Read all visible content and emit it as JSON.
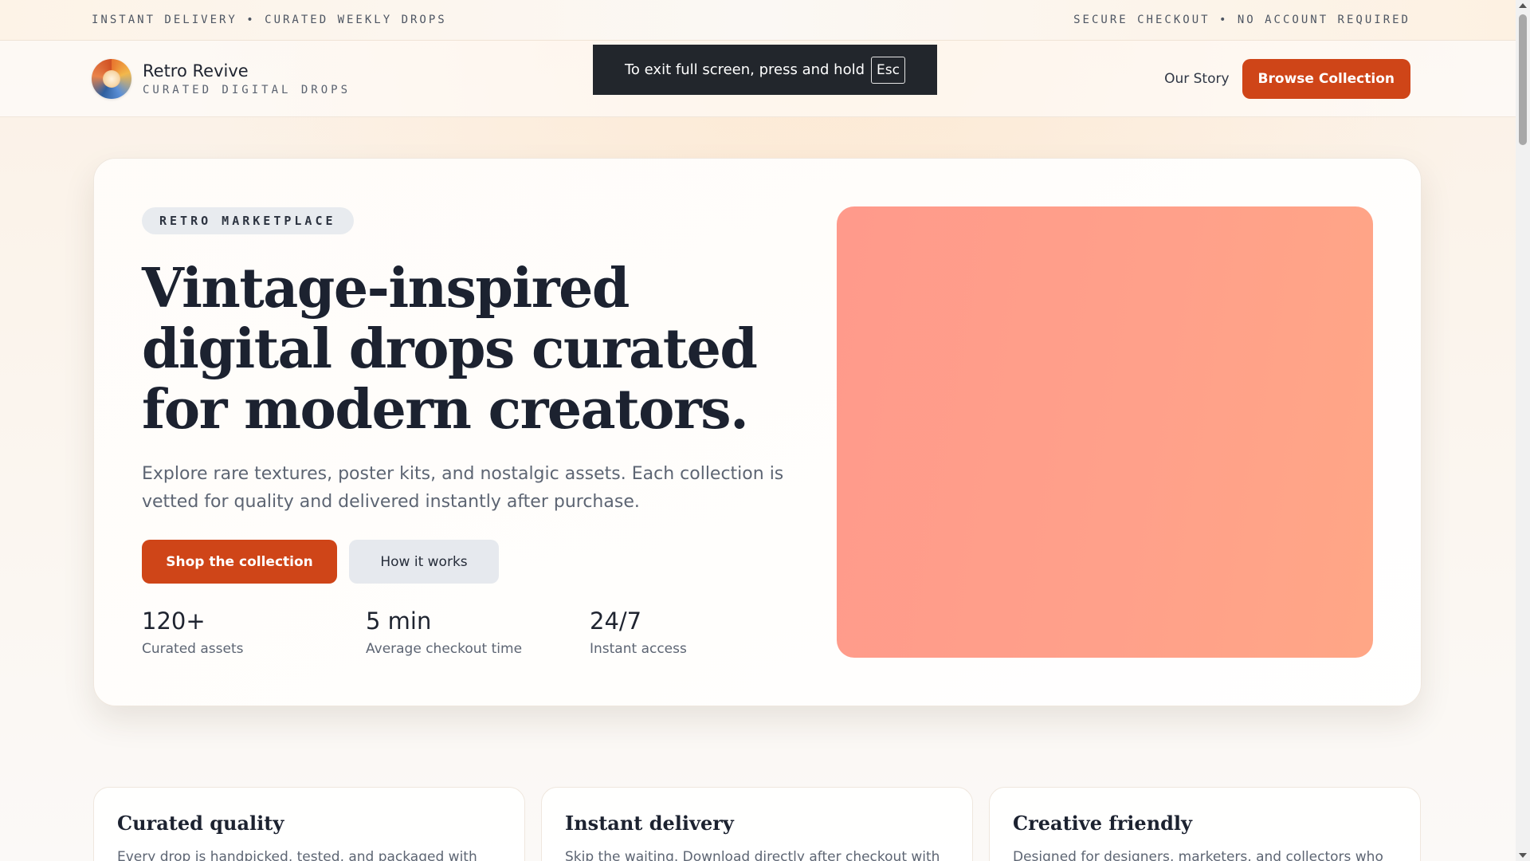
{
  "announce": {
    "left": "INSTANT DELIVERY • CURATED WEEKLY DROPS",
    "right": "SECURE CHECKOUT • NO ACCOUNT REQUIRED"
  },
  "header": {
    "brand_name": "Retro Revive",
    "brand_sub": "CURATED DIGITAL DROPS",
    "nav_link": "Our Story",
    "cta": "Browse Collection"
  },
  "toast": {
    "text": "To exit full screen, press and hold",
    "key": "Esc"
  },
  "hero": {
    "tag": "RETRO MARKETPLACE",
    "title": "Vintage-inspired digital drops curated for modern creators.",
    "description": "Explore rare textures, poster kits, and nostalgic assets. Each collection is vetted for quality and delivered instantly after purchase.",
    "primary_button": "Shop the collection",
    "secondary_button": "How it works",
    "stats": [
      {
        "value": "120+",
        "label": "Curated assets"
      },
      {
        "value": "5 min",
        "label": "Average checkout time"
      },
      {
        "value": "24/7",
        "label": "Instant access"
      }
    ]
  },
  "features": [
    {
      "title": "Curated quality",
      "text": "Every drop is handpicked, tested, and packaged with"
    },
    {
      "title": "Instant delivery",
      "text": "Skip the waiting. Download directly after checkout with"
    },
    {
      "title": "Creative friendly",
      "text": "Designed for designers, marketers, and collectors who"
    }
  ],
  "colors": {
    "accent": "#cf4518",
    "hero_art_start": "#ff9a8b",
    "hero_art_end": "#ffa686"
  }
}
